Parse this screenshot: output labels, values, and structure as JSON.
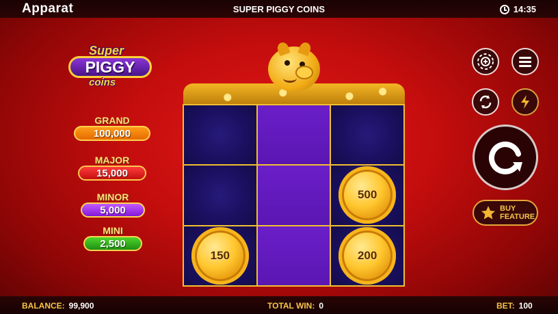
{
  "header": {
    "brand": "Apparat",
    "game_title": "SUPER PIGGY COINS",
    "clock": "14:35"
  },
  "logo": {
    "line1": "Super",
    "line2": "PIGGY",
    "line3": "coins"
  },
  "jackpots": [
    {
      "name": "GRAND",
      "value": "100,000"
    },
    {
      "name": "MAJOR",
      "value": "15,000"
    },
    {
      "name": "MINOR",
      "value": "5,000"
    },
    {
      "name": "MINI",
      "value": "2,500"
    }
  ],
  "grid": {
    "cells": [
      {
        "coin": ""
      },
      {
        "coin": ""
      },
      {
        "coin": ""
      },
      {
        "coin": ""
      },
      {
        "coin": ""
      },
      {
        "coin": "500"
      },
      {
        "coin": "150"
      },
      {
        "coin": ""
      },
      {
        "coin": "200"
      }
    ],
    "highlight_column": 2
  },
  "controls": {
    "buy_feature_line1": "BUY",
    "buy_feature_line2": "FEATURE",
    "icons": [
      "chip-icon",
      "menu-icon",
      "autoplay-icon",
      "turbo-icon",
      "spin-icon",
      "star-icon"
    ]
  },
  "footer": {
    "balance_label": "BALANCE:",
    "balance_value": "99,900",
    "total_win_label": "TOTAL WIN:",
    "total_win_value": "0",
    "bet_label": "BET:",
    "bet_value": "100"
  },
  "colors": {
    "accent_gold": "#f2c030",
    "background_red": "#c40d0d",
    "cell_navy": "#1a1060",
    "highlight_purple": "#5a16b2"
  }
}
